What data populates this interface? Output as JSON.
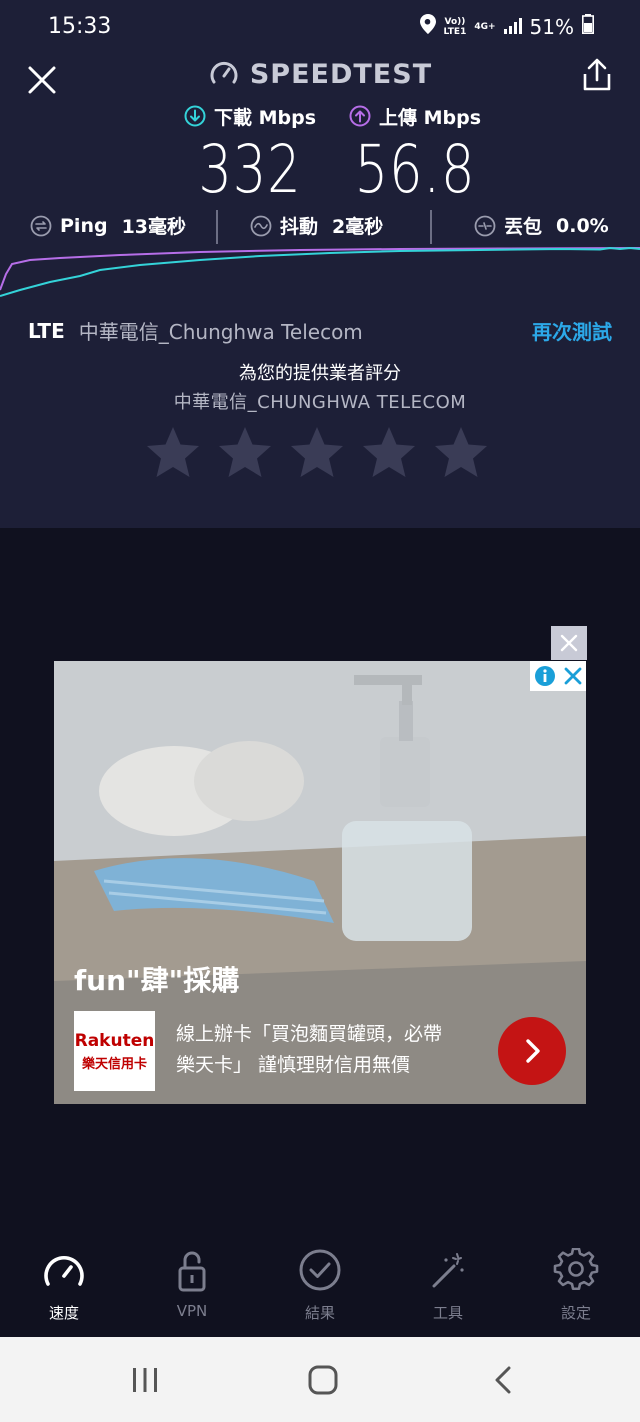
{
  "status_bar": {
    "time": "15:33",
    "volte_line1": "Vo))",
    "volte_line2": "LTE1",
    "net": "4G+",
    "battery": "51%"
  },
  "header": {
    "title": "SPEEDTEST"
  },
  "speeds": {
    "download_label": "下載 Mbps",
    "download_value": "332",
    "upload_label": "上傳 Mbps",
    "upload_value": "56.8"
  },
  "metrics": {
    "ping_label": "Ping",
    "ping_value": "13毫秒",
    "jitter_label": "抖動",
    "jitter_value": "2毫秒",
    "loss_label": "丟包",
    "loss_value": "0.0%"
  },
  "connection": {
    "type": "LTE",
    "carrier": "中華電信_Chunghwa Telecom",
    "retest": "再次測試"
  },
  "rating": {
    "prompt": "為您的提供業者評分",
    "provider": "中華電信_CHUNGHWA TELECOM",
    "stars": [
      1,
      2,
      3,
      4,
      5
    ]
  },
  "ad": {
    "headline": "fun\"肆\"採購",
    "logo_top": "Rakuten",
    "logo_bottom": "樂天信用卡",
    "body_line1": "線上辦卡「買泡麵買罐頭，必帶",
    "body_line2": "樂天卡」 謹慎理財信用無價",
    "info_icon": "info-icon",
    "close_icon": "close-icon"
  },
  "bottom_nav": [
    {
      "label": "速度",
      "icon": "speed-gauge-icon",
      "active": true
    },
    {
      "label": "VPN",
      "icon": "lock-icon",
      "active": false
    },
    {
      "label": "結果",
      "icon": "check-circle-icon",
      "active": false
    },
    {
      "label": "工具",
      "icon": "magic-wand-icon",
      "active": false
    },
    {
      "label": "設定",
      "icon": "gear-icon",
      "active": false
    }
  ],
  "colors": {
    "panel_bg": "#1d1f37",
    "page_bg": "#10111f",
    "download_accent": "#34d3d9",
    "upload_accent": "#b66ee8",
    "link": "#2ca8e8",
    "cta_red": "#c41414"
  }
}
